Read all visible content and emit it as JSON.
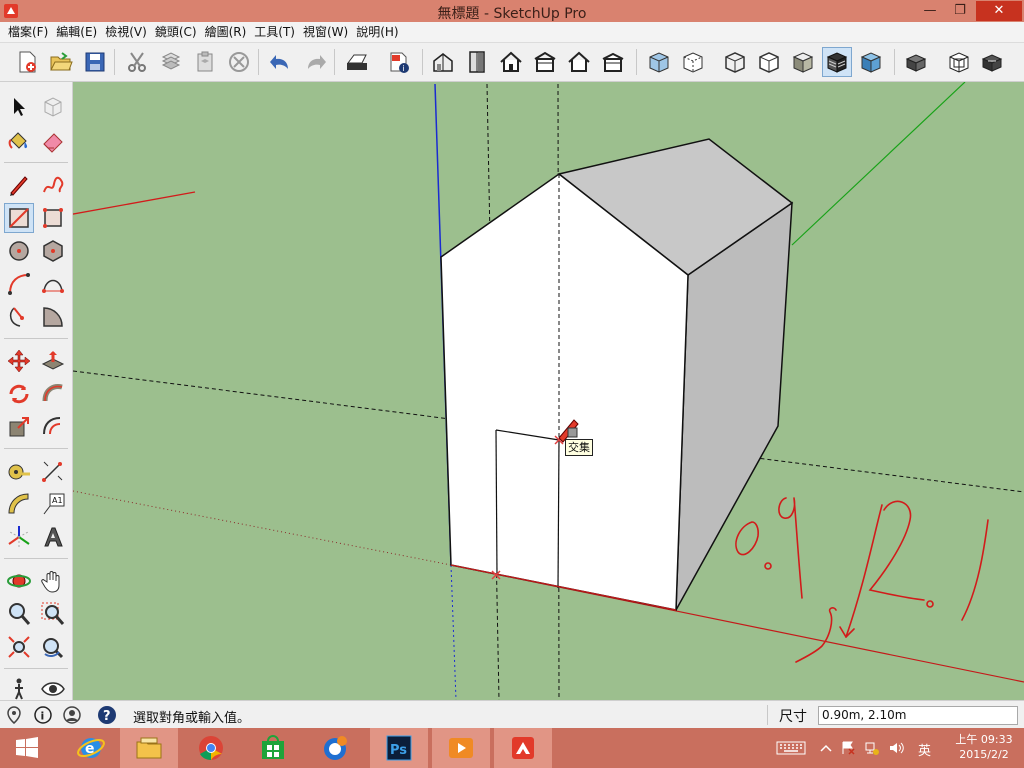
{
  "window": {
    "title": "無標題 - SketchUp Pro",
    "minimize": "—",
    "restore": "❐",
    "close": "✕"
  },
  "menu": [
    "檔案(F)",
    "編輯(E)",
    "檢視(V)",
    "鏡頭(C)",
    "繪圖(R)",
    "工具(T)",
    "視窗(W)",
    "說明(H)"
  ],
  "toolbar": {
    "icons": [
      "new-icon",
      "open-icon",
      "save-icon",
      "cut-icon",
      "copy-icon",
      "paste-icon",
      "erase-icon",
      "undo-icon",
      "redo-icon",
      "print-icon",
      "model-info-icon",
      "iso-view-icon",
      "top-view-icon",
      "front-view-icon",
      "right-view-icon",
      "back-view-icon",
      "left-view-icon",
      "xray-icon",
      "back-edges-icon",
      "wireframe-icon",
      "hidden-line-icon",
      "shaded-icon",
      "shaded-textures-icon",
      "monochrome-icon",
      "section-plane-icon",
      "section-cut-icon",
      "section-fill-icon"
    ],
    "active_style": "shaded-textures-icon"
  },
  "left_tools": {
    "icons": [
      "select-icon",
      "component-icon",
      "paint-bucket-icon",
      "eraser-icon",
      "line-icon",
      "freehand-icon",
      "rectangle-icon",
      "rotated-rectangle-icon",
      "circle-icon",
      "polygon-icon",
      "arc-icon",
      "two-point-arc-icon",
      "three-point-arc-icon",
      "pie-icon",
      "move-icon",
      "push-pull-icon",
      "rotate-icon",
      "follow-me-icon",
      "scale-icon",
      "offset-icon",
      "tape-measure-icon",
      "dimension-icon",
      "protractor-icon",
      "text-icon",
      "axes-icon",
      "3d-text-icon",
      "orbit-icon",
      "pan-icon",
      "zoom-icon",
      "zoom-window-icon",
      "zoom-extents-icon",
      "previous-view-icon",
      "walk-icon",
      "look-around-icon"
    ],
    "active": "rectangle-icon"
  },
  "viewport": {
    "tooltip": "交集",
    "colors": {
      "ground": "#9cbf8e",
      "annotation": "#d21b1b",
      "blue_axis": "#1a2bd1",
      "green_axis": "#18a218",
      "red_axis": "#c41a1a"
    }
  },
  "status": {
    "message": "選取對角或輸入值。",
    "measure_label": "尺寸",
    "measure_value": "0.90m, 2.10m"
  },
  "taskbar": {
    "apps": [
      "windows-start-icon",
      "internet-explorer-icon",
      "file-explorer-icon",
      "chrome-icon",
      "store-icon",
      "messenger-icon",
      "photoshop-icon",
      "media-player-icon",
      "sketchup-icon"
    ],
    "ime": "英",
    "time": "上午 09:33",
    "date": "2015/2/2"
  }
}
